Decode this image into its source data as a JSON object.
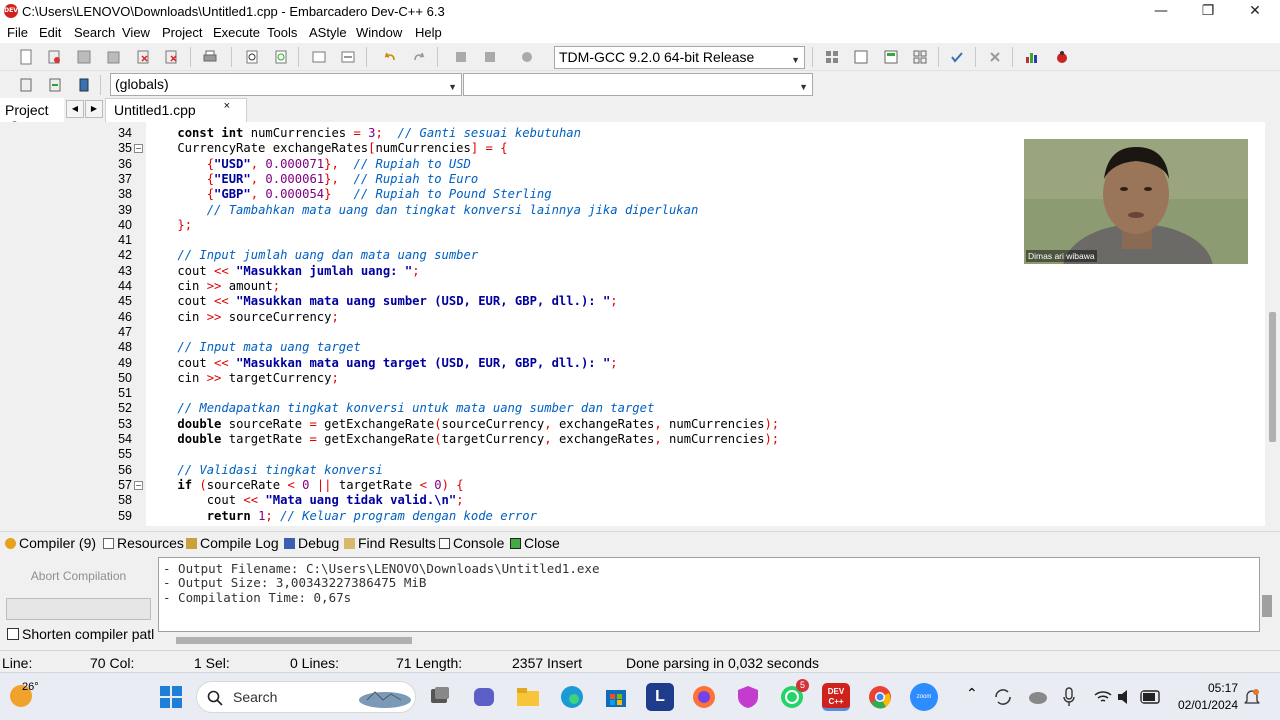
{
  "window": {
    "title": "C:\\Users\\LENOVO\\Downloads\\Untitled1.cpp - Embarcadero Dev-C++ 6.3",
    "app_icon_text": "DEV",
    "minimize": "—",
    "maximize": "❐",
    "close": "✕"
  },
  "menu": [
    "File",
    "Edit",
    "Search",
    "View",
    "Project",
    "Execute",
    "Tools",
    "AStyle",
    "Window",
    "Help"
  ],
  "toolbar": {
    "compiler_select": "TDM-GCC 9.2.0 64-bit Release",
    "scope_select": "(globals)",
    "symbol_select": ""
  },
  "tabs": {
    "left_panel_tab": "Project",
    "left_panel_tab2": "C",
    "file_tab": "Untitled1.cpp",
    "close_glyph": "×"
  },
  "editor": {
    "lines": [
      {
        "n": "34",
        "fold": "",
        "segs": [
          [
            "    ",
            "txt"
          ],
          [
            "const int",
            "kw"
          ],
          [
            " numCurrencies ",
            "txt"
          ],
          [
            "=",
            "sym"
          ],
          [
            " ",
            "txt"
          ],
          [
            "3",
            "num"
          ],
          [
            ";",
            "sym"
          ],
          [
            "  ",
            "txt"
          ],
          [
            "// Ganti sesuai kebutuhan",
            "cmt"
          ]
        ]
      },
      {
        "n": "35",
        "fold": "−",
        "segs": [
          [
            "    CurrencyRate exchangeRates",
            "txt"
          ],
          [
            "[",
            "sym"
          ],
          [
            "numCurrencies",
            "txt"
          ],
          [
            "]",
            "sym"
          ],
          [
            " ",
            "txt"
          ],
          [
            "=",
            "sym"
          ],
          [
            " ",
            "txt"
          ],
          [
            "{",
            "sym"
          ]
        ]
      },
      {
        "n": "36",
        "fold": "",
        "segs": [
          [
            "        ",
            "txt"
          ],
          [
            "{",
            "sym"
          ],
          [
            "\"USD\"",
            "str"
          ],
          [
            ", ",
            "sym"
          ],
          [
            "0.000071",
            "num"
          ],
          [
            "},",
            "sym"
          ],
          [
            "  ",
            "txt"
          ],
          [
            "// Rupiah to USD",
            "cmt"
          ]
        ]
      },
      {
        "n": "37",
        "fold": "",
        "segs": [
          [
            "        ",
            "txt"
          ],
          [
            "{",
            "sym"
          ],
          [
            "\"EUR\"",
            "str"
          ],
          [
            ", ",
            "sym"
          ],
          [
            "0.000061",
            "num"
          ],
          [
            "},",
            "sym"
          ],
          [
            "  ",
            "txt"
          ],
          [
            "// Rupiah to Euro",
            "cmt"
          ]
        ]
      },
      {
        "n": "38",
        "fold": "",
        "segs": [
          [
            "        ",
            "txt"
          ],
          [
            "{",
            "sym"
          ],
          [
            "\"GBP\"",
            "str"
          ],
          [
            ", ",
            "sym"
          ],
          [
            "0.000054",
            "num"
          ],
          [
            "}",
            "sym"
          ],
          [
            "   ",
            "txt"
          ],
          [
            "// Rupiah to Pound Sterling",
            "cmt"
          ]
        ]
      },
      {
        "n": "39",
        "fold": "",
        "segs": [
          [
            "        ",
            "txt"
          ],
          [
            "// Tambahkan mata uang dan tingkat konversi lainnya jika diperlukan",
            "cmt"
          ]
        ]
      },
      {
        "n": "40",
        "fold": "",
        "segs": [
          [
            "    ",
            "txt"
          ],
          [
            "};",
            "sym"
          ]
        ]
      },
      {
        "n": "41",
        "fold": "",
        "segs": [
          [
            "",
            "txt"
          ]
        ]
      },
      {
        "n": "42",
        "fold": "",
        "segs": [
          [
            "    ",
            "txt"
          ],
          [
            "// Input jumlah uang dan mata uang sumber",
            "cmt"
          ]
        ]
      },
      {
        "n": "43",
        "fold": "",
        "segs": [
          [
            "    cout ",
            "txt"
          ],
          [
            "<<",
            "sym"
          ],
          [
            " ",
            "txt"
          ],
          [
            "\"Masukkan jumlah uang: \"",
            "str"
          ],
          [
            ";",
            "sym"
          ]
        ]
      },
      {
        "n": "44",
        "fold": "",
        "segs": [
          [
            "    cin ",
            "txt"
          ],
          [
            ">>",
            "sym"
          ],
          [
            " amount",
            "txt"
          ],
          [
            ";",
            "sym"
          ]
        ]
      },
      {
        "n": "45",
        "fold": "",
        "segs": [
          [
            "    cout ",
            "txt"
          ],
          [
            "<<",
            "sym"
          ],
          [
            " ",
            "txt"
          ],
          [
            "\"Masukkan mata uang sumber (USD, EUR, GBP, dll.): \"",
            "str"
          ],
          [
            ";",
            "sym"
          ]
        ]
      },
      {
        "n": "46",
        "fold": "",
        "segs": [
          [
            "    cin ",
            "txt"
          ],
          [
            ">>",
            "sym"
          ],
          [
            " sourceCurrency",
            "txt"
          ],
          [
            ";",
            "sym"
          ]
        ]
      },
      {
        "n": "47",
        "fold": "",
        "segs": [
          [
            "",
            "txt"
          ]
        ]
      },
      {
        "n": "48",
        "fold": "",
        "segs": [
          [
            "    ",
            "txt"
          ],
          [
            "// Input mata uang target",
            "cmt"
          ]
        ]
      },
      {
        "n": "49",
        "fold": "",
        "segs": [
          [
            "    cout ",
            "txt"
          ],
          [
            "<<",
            "sym"
          ],
          [
            " ",
            "txt"
          ],
          [
            "\"Masukkan mata uang target (USD, EUR, GBP, dll.): \"",
            "str"
          ],
          [
            ";",
            "sym"
          ]
        ]
      },
      {
        "n": "50",
        "fold": "",
        "segs": [
          [
            "    cin ",
            "txt"
          ],
          [
            ">>",
            "sym"
          ],
          [
            " targetCurrency",
            "txt"
          ],
          [
            ";",
            "sym"
          ]
        ]
      },
      {
        "n": "51",
        "fold": "",
        "segs": [
          [
            "",
            "txt"
          ]
        ]
      },
      {
        "n": "52",
        "fold": "",
        "segs": [
          [
            "    ",
            "txt"
          ],
          [
            "// Mendapatkan tingkat konversi untuk mata uang sumber dan target",
            "cmt"
          ]
        ]
      },
      {
        "n": "53",
        "fold": "",
        "segs": [
          [
            "    ",
            "txt"
          ],
          [
            "double",
            "kw"
          ],
          [
            " sourceRate ",
            "txt"
          ],
          [
            "=",
            "sym"
          ],
          [
            " getExchangeRate",
            "txt"
          ],
          [
            "(",
            "sym"
          ],
          [
            "sourceCurrency",
            "txt"
          ],
          [
            ",",
            "sym"
          ],
          [
            " exchangeRates",
            "txt"
          ],
          [
            ",",
            "sym"
          ],
          [
            " numCurrencies",
            "txt"
          ],
          [
            ");",
            "sym"
          ]
        ]
      },
      {
        "n": "54",
        "fold": "",
        "segs": [
          [
            "    ",
            "txt"
          ],
          [
            "double",
            "kw"
          ],
          [
            " targetRate ",
            "txt"
          ],
          [
            "=",
            "sym"
          ],
          [
            " getExchangeRate",
            "txt"
          ],
          [
            "(",
            "sym"
          ],
          [
            "targetCurrency",
            "txt"
          ],
          [
            ",",
            "sym"
          ],
          [
            " exchangeRates",
            "txt"
          ],
          [
            ",",
            "sym"
          ],
          [
            " numCurrencies",
            "txt"
          ],
          [
            ");",
            "sym"
          ]
        ]
      },
      {
        "n": "55",
        "fold": "",
        "segs": [
          [
            "",
            "txt"
          ]
        ]
      },
      {
        "n": "56",
        "fold": "",
        "segs": [
          [
            "    ",
            "txt"
          ],
          [
            "// Validasi tingkat konversi",
            "cmt"
          ]
        ]
      },
      {
        "n": "57",
        "fold": "−",
        "segs": [
          [
            "    ",
            "txt"
          ],
          [
            "if",
            "kw"
          ],
          [
            " ",
            "txt"
          ],
          [
            "(",
            "sym"
          ],
          [
            "sourceRate ",
            "txt"
          ],
          [
            "<",
            "sym"
          ],
          [
            " ",
            "txt"
          ],
          [
            "0",
            "num"
          ],
          [
            " ",
            "txt"
          ],
          [
            "||",
            "sym"
          ],
          [
            " targetRate ",
            "txt"
          ],
          [
            "<",
            "sym"
          ],
          [
            " ",
            "txt"
          ],
          [
            "0",
            "num"
          ],
          [
            ")",
            "sym"
          ],
          [
            " ",
            "txt"
          ],
          [
            "{",
            "sym"
          ]
        ]
      },
      {
        "n": "58",
        "fold": "",
        "segs": [
          [
            "        cout ",
            "txt"
          ],
          [
            "<<",
            "sym"
          ],
          [
            " ",
            "txt"
          ],
          [
            "\"Mata uang tidak valid.\\n\"",
            "str"
          ],
          [
            ";",
            "sym"
          ]
        ]
      },
      {
        "n": "59",
        "fold": "",
        "segs": [
          [
            "        ",
            "txt"
          ],
          [
            "return",
            "kw"
          ],
          [
            " ",
            "txt"
          ],
          [
            "1",
            "num"
          ],
          [
            ";",
            "sym"
          ],
          [
            " ",
            "txt"
          ],
          [
            "// Keluar program dengan kode error",
            "cmt"
          ]
        ]
      }
    ]
  },
  "webcam": {
    "name_label": "Dimas ari wibawa"
  },
  "bottom_tabs": [
    "Compiler (9)",
    "Resources",
    "Compile Log",
    "Debug",
    "Find Results",
    "Console",
    "Close"
  ],
  "log": {
    "abort_button": "Abort Compilation",
    "shorten_label": "Shorten compiler patl",
    "lines": [
      "- Output Filename: C:\\Users\\LENOVO\\Downloads\\Untitled1.exe",
      "- Output Size: 3,00343227386475 MiB",
      "- Compilation Time: 0,67s"
    ]
  },
  "status": {
    "line_label": "Line:",
    "line_value": "70 Col:",
    "col_value": "1 Sel:",
    "sel_value": "0 Lines:",
    "lines_value": "71 Length:",
    "length_value": "2357 Insert",
    "parse_msg": "Done parsing in 0,032 seconds"
  },
  "taskbar": {
    "weather": "26°",
    "search": "Search",
    "whatsapp_badge": "5",
    "time": "05:17",
    "date": "02/01/2024",
    "app_letter": "L",
    "dev_label": "DEV C++",
    "zoom_label": "zoom"
  },
  "colors": {
    "keyword": "#000000",
    "string": "#0000a0",
    "number": "#800080",
    "comment": "#0060c0",
    "symbol": "#e00000"
  }
}
